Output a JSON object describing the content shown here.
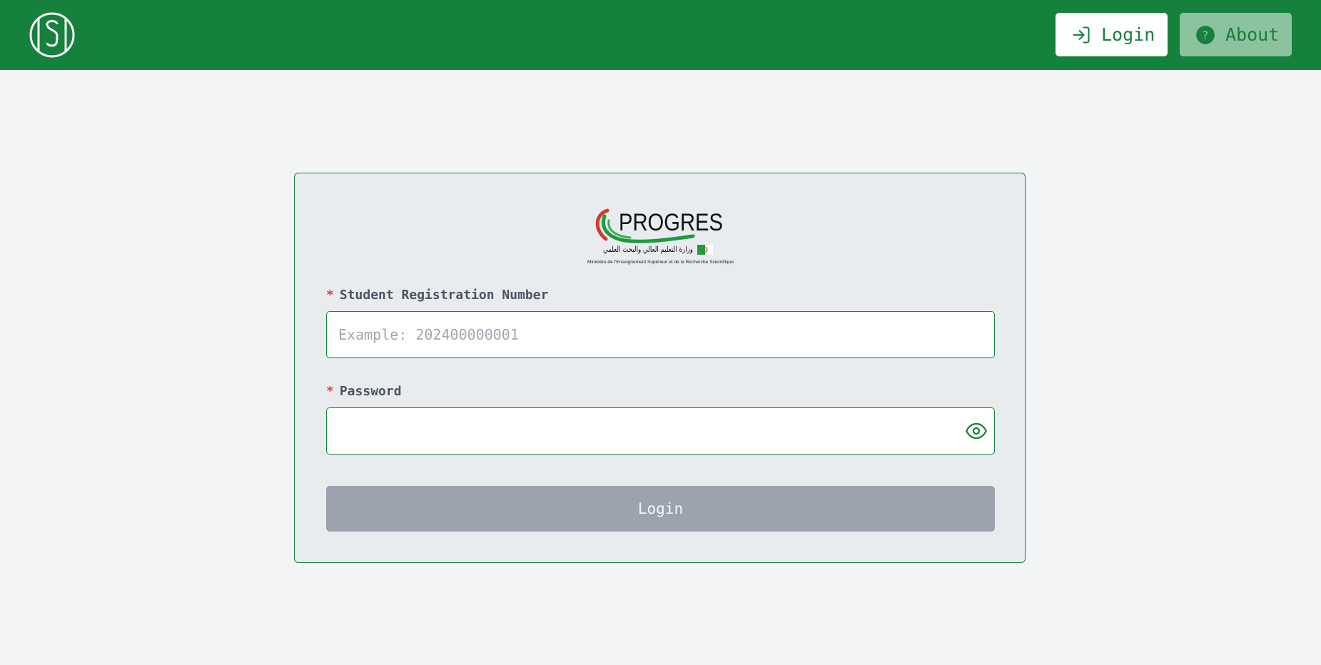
{
  "header": {
    "logo_name": "osc-logo",
    "login_label": "Login",
    "about_label": "About",
    "brand_color": "#16803d"
  },
  "form": {
    "logo_text": "PROGRES",
    "logo_arabic": "وزارة التعليم العالي والبحث العلمي",
    "logo_french": "Ministère de l'Enseignement Supérieur et de la Recherche Scientifique",
    "required_mark": "*",
    "registration_label": "Student Registration Number",
    "registration_placeholder": "Example: 202400000001",
    "registration_value": "",
    "password_label": "Password",
    "password_value": "",
    "submit_label": "Login"
  }
}
